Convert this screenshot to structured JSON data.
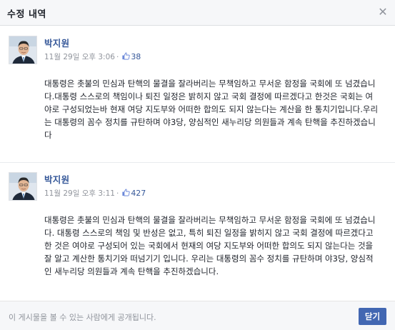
{
  "dialog": {
    "title": "수정 내역",
    "close_glyph": "✕",
    "close_icon": "close-icon"
  },
  "entries": [
    {
      "author": "박지원",
      "date": "11월 29일 오후 3:06",
      "separator": "·",
      "like_icon": "thumbs-up-icon",
      "likes": "38",
      "text": "대통령은 촛불의 민심과 탄핵의 물결을 잘라버리는 무책임하고 무서운 함정을 국회에 또 넘겼습니다.대통령 스스로의 책임이나 퇴진 일정은 밝히지 않고 국회 결정에 따르겠다고 한것은 국회는 여야로 구성되었는바 현재 여당 지도부와 어떠한 합의도 되지 않는다는 계산을 한 통치기입니다.우리는 대통령의 꼼수 정치를 규탄하며 야3당, 양심적인 새누리당 의원들과 계속 탄핵을 추진하겠습니다"
    },
    {
      "author": "박지원",
      "date": "11월 29일 오후 3:11",
      "separator": "·",
      "like_icon": "thumbs-up-icon",
      "likes": "427",
      "text": "대통령은 촛불의 민심과 탄핵의 물결을 잘라버리는 무책임하고 무서운 함정을 국회에 또 넘겼습니다. 대통령 스스로의 책임 및 반성은 없고, 특히 퇴진 일정을 밝히지 않고 국회 결정에 따르겠다고 한 것은 여야로 구성되어 있는 국회에서 현재의 여당 지도부와 어떠한 합의도 되지 않는다는 것을 잘 알고 계산한 통치기와 떠넘기기 입니다. 우리는 대통령의 꼼수 정치를 규탄하며 야3당, 양심적인 새누리당 의원들과 계속 탄핵을 추진하겠습니다."
    }
  ],
  "footer": {
    "note": "이 게시물을 볼 수 있는 사람에게 공개됩니다.",
    "close_label": "닫기"
  },
  "colors": {
    "accent": "#4267b2",
    "link": "#365899",
    "muted": "#90949c"
  }
}
